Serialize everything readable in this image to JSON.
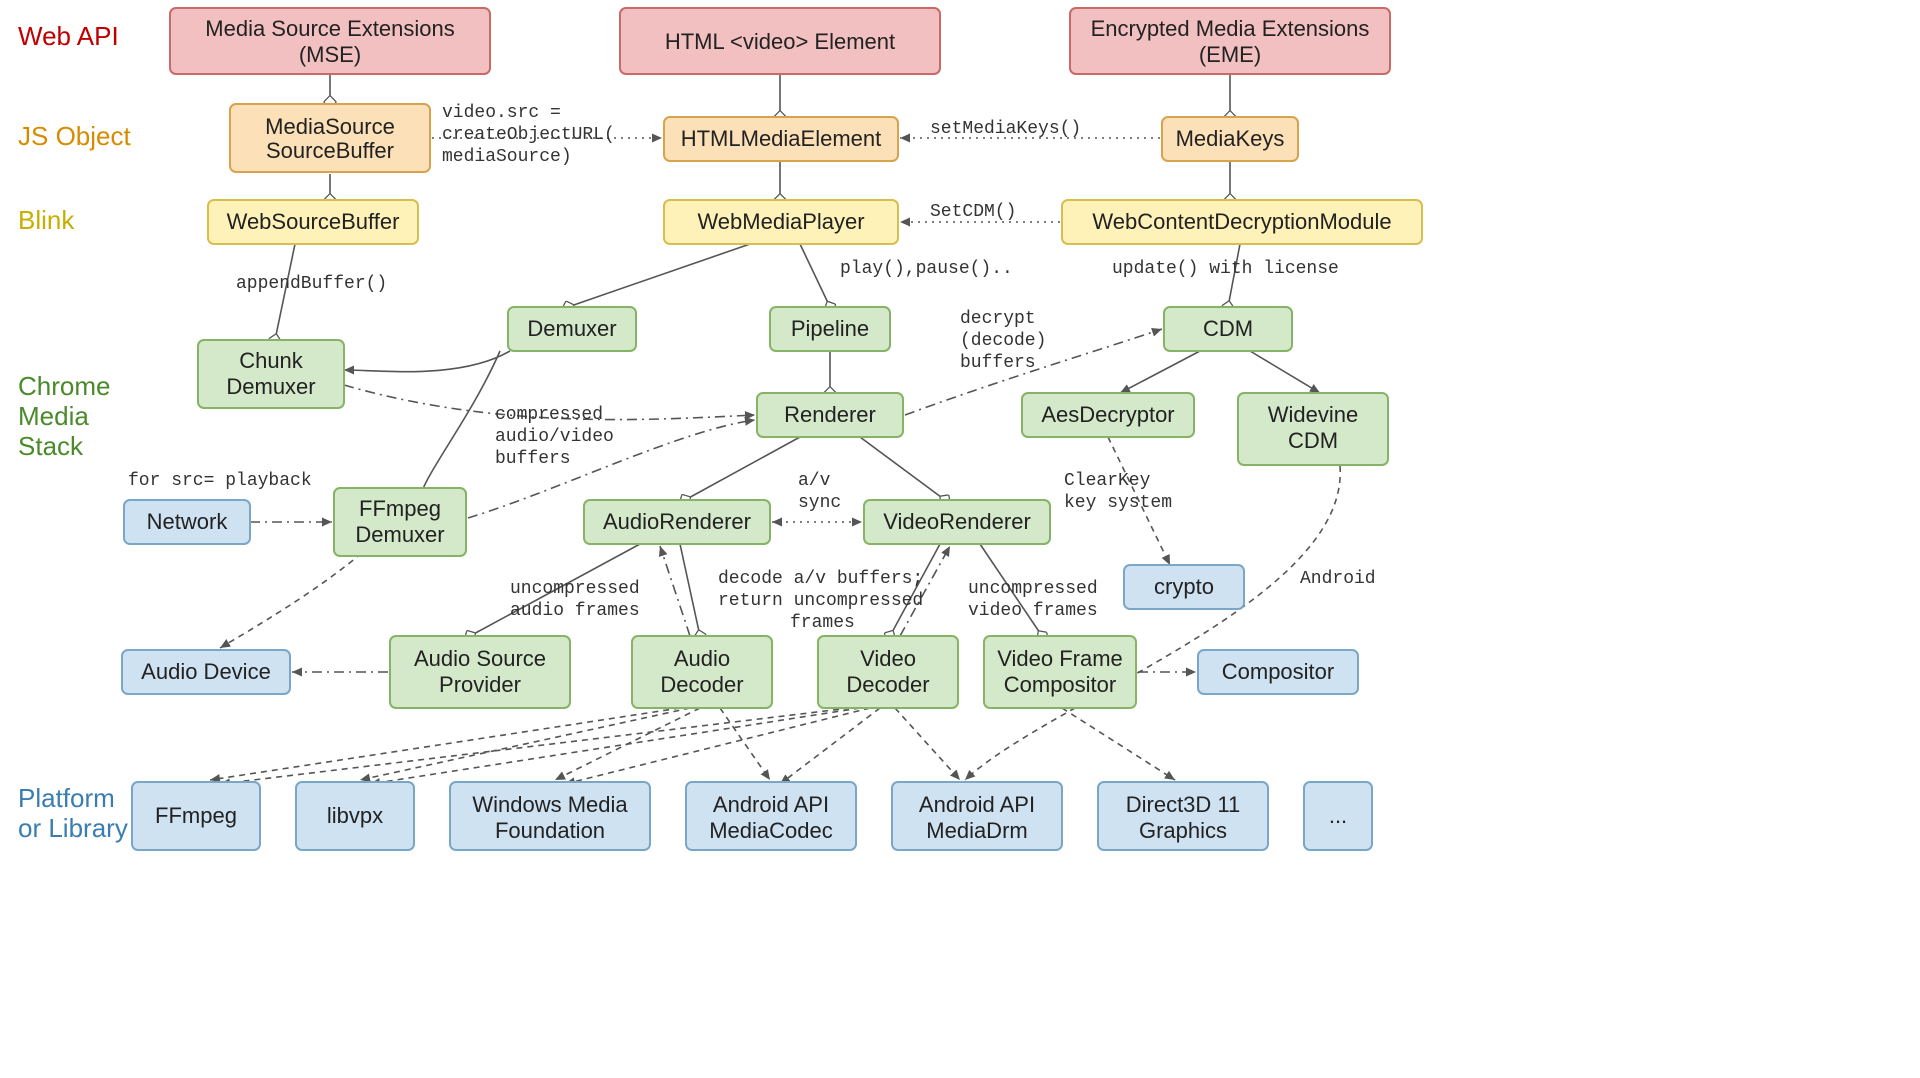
{
  "rowLabels": {
    "webapi": "Web API",
    "jsobject": "JS Object",
    "blink": "Blink",
    "chrome1": "Chrome",
    "chrome2": "Media",
    "chrome3": "Stack",
    "platform1": "Platform",
    "platform2": "or Library"
  },
  "colors": {
    "webapi": "#c00000",
    "jsobject": "#d78b00",
    "blink": "#d7be00",
    "chrome": "#4a8a2a",
    "platform": "#3a7db0"
  },
  "nodes": {
    "mse1": "Media Source Extensions",
    "mse2": "(MSE)",
    "video": "HTML <video> Element",
    "eme1": "Encrypted Media Extensions",
    "eme2": "(EME)",
    "mediasource1": "MediaSource",
    "mediasource2": "SourceBuffer",
    "htmlmediaelement": "HTMLMediaElement",
    "mediakeys": "MediaKeys",
    "websourcebuffer": "WebSourceBuffer",
    "webmediaplayer": "WebMediaPlayer",
    "webcdm": "WebContentDecryptionModule",
    "chunk1": "Chunk",
    "chunk2": "Demuxer",
    "demuxer": "Demuxer",
    "pipeline": "Pipeline",
    "cdm": "CDM",
    "renderer": "Renderer",
    "aesdecryptor": "AesDecryptor",
    "widevine1": "Widevine",
    "widevine2": "CDM",
    "network": "Network",
    "ffmpegdemux1": "FFmpeg",
    "ffmpegdemux2": "Demuxer",
    "audiorenderer": "AudioRenderer",
    "videorenderer": "VideoRenderer",
    "crypto": "crypto",
    "audiodevice": "Audio Device",
    "asp1": "Audio Source",
    "asp2": "Provider",
    "audiodecoder1": "Audio",
    "audiodecoder2": "Decoder",
    "videodecoder1": "Video",
    "videodecoder2": "Decoder",
    "vfc1": "Video Frame",
    "vfc2": "Compositor",
    "compositor": "Compositor",
    "ffmpeg": "FFmpeg",
    "libvpx": "libvpx",
    "wmf1": "Windows Media",
    "wmf2": "Foundation",
    "androidmc1": "Android API",
    "androidmc2": "MediaCodec",
    "androiddrm1": "Android API",
    "androiddrm2": "MediaDrm",
    "d3d1": "Direct3D 11",
    "d3d2": "Graphics",
    "ellipsis": "..."
  },
  "edgeLabels": {
    "videosrc1": "video.src =",
    "videosrc2": "createObjectURL(",
    "videosrc3": "mediaSource)",
    "setmediakeys": "setMediaKeys()",
    "setcdm": "SetCDM()",
    "appendbuffer": "appendBuffer()",
    "playpause": "play(),pause()..",
    "updatelicense": "update() with license",
    "compressed1": "compressed",
    "compressed2": "audio/video",
    "compressed3": "buffers",
    "decrypt1": "decrypt",
    "decrypt2": "(decode)",
    "decrypt3": "buffers",
    "avsync1": "a/v",
    "avsync2": "sync",
    "srcplayback": "for src= playback",
    "clearkey1": "ClearKey",
    "clearkey2": "key system",
    "android": "Android",
    "uncompaudio1": "uncompressed",
    "uncompaudio2": "audio frames",
    "decodeav1": "decode a/v buffers;",
    "decodeav2": "return uncompressed",
    "decodeav3": "frames",
    "uncompvideo1": "uncompressed",
    "uncompvideo2": "video frames"
  }
}
